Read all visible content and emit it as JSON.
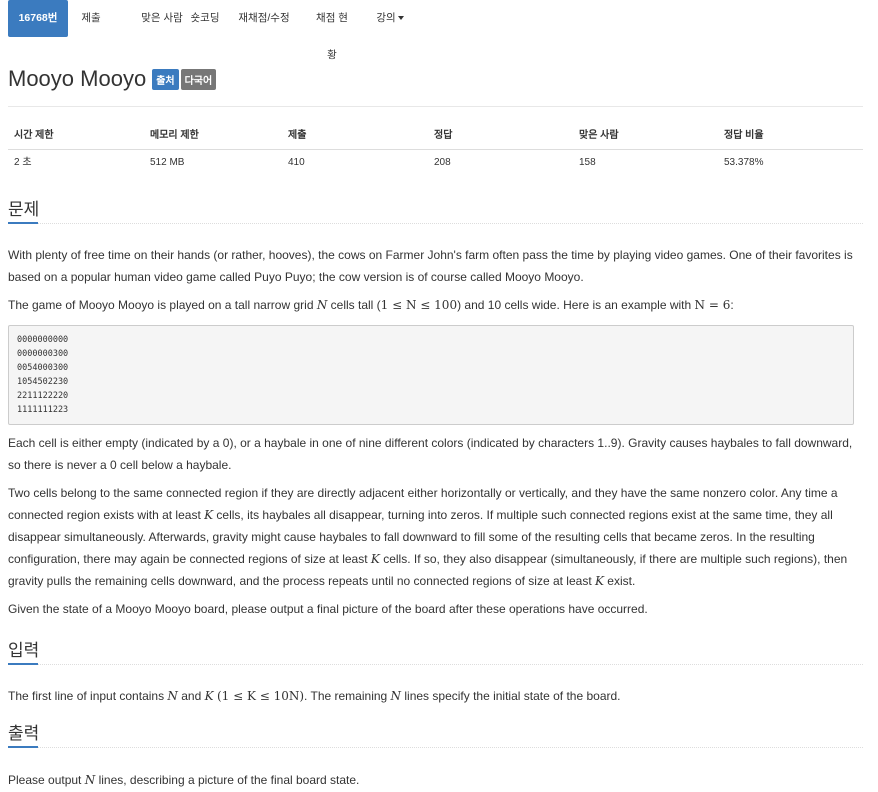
{
  "nav": {
    "tabs": [
      "16768번",
      "제출",
      "맞은 사람",
      "숏코딩",
      "재채점/수정",
      "채점 현황",
      "강의"
    ]
  },
  "problem": {
    "title": "Mooyo Mooyo",
    "label_source": "출처",
    "label_multilang": "다국어"
  },
  "stats": {
    "headers": [
      "시간 제한",
      "메모리 제한",
      "제출",
      "정답",
      "맞은 사람",
      "정답 비율"
    ],
    "values": [
      "2 초",
      "512 MB",
      "410",
      "208",
      "158",
      "53.378%"
    ]
  },
  "sections": {
    "problem": "문제",
    "input": "입력",
    "output": "출력"
  },
  "statement": {
    "p1": "With plenty of free time on their hands (or rather, hooves), the cows on Farmer John's farm often pass the time by playing video games. One of their favorites is based on a popular human video game called Puyo Puyo; the cow version is of course called Mooyo Mooyo.",
    "p2_a": "The game of Mooyo Mooyo is played on a tall narrow grid ",
    "p2_b": " cells tall (",
    "p2_c": ") and 10 cells wide. Here is an example with ",
    "p2_d": ":",
    "example": [
      "0000000000",
      "0000000300",
      "0054000300",
      "1054502230",
      "2211122220",
      "1111111223"
    ],
    "p3": "Each cell is either empty (indicated by a 0), or a haybale in one of nine different colors (indicated by characters 1..9). Gravity causes haybales to fall downward, so there is never a 0 cell below a haybale.",
    "p4_a": "Two cells belong to the same connected region if they are directly adjacent either horizontally or vertically, and they have the same nonzero color. Any time a connected region exists with at least ",
    "p4_b": " cells, its haybales all disappear, turning into zeros. If multiple such connected regions exist at the same time, they all disappear simultaneously. Afterwards, gravity might cause haybales to fall downward to fill some of the resulting cells that became zeros. In the resulting configuration, there may again be connected regions of size at least ",
    "p4_c": " cells. If so, they also disappear (simultaneously, if there are multiple such regions), then gravity pulls the remaining cells downward, and the process repeats until no connected regions of size at least ",
    "p4_d": " exist.",
    "p5": "Given the state of a Mooyo Mooyo board, please output a final picture of the board after these operations have occurred."
  },
  "input": {
    "a": "The first line of input contains ",
    "b": " and ",
    "c": ". The remaining ",
    "d": " lines specify the initial state of the board."
  },
  "output": {
    "a": "Please output ",
    "b": " lines, describing a picture of the final board state."
  },
  "math": {
    "N": "N",
    "K": "K",
    "n_range": "1 ≤ N ≤ 100",
    "n_eq": "N = 6",
    "k_range": "(1 ≤ K ≤ 10N)"
  }
}
